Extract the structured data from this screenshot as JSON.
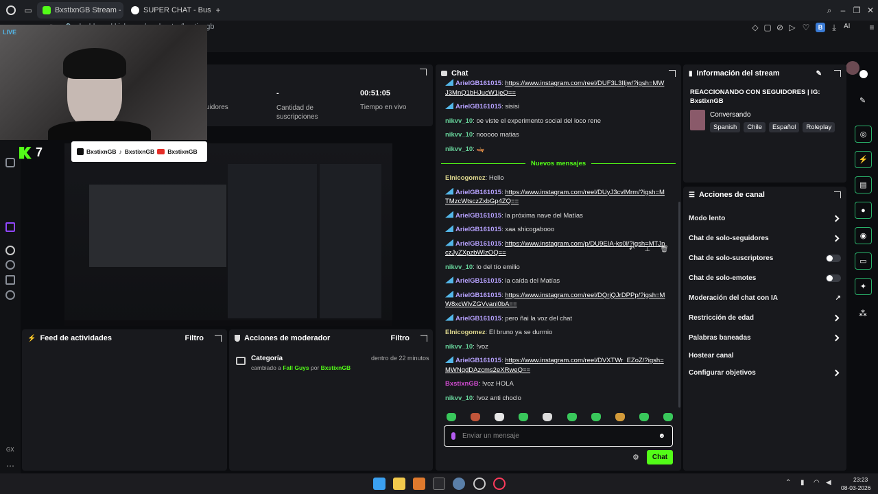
{
  "browser": {
    "tabs": [
      {
        "label": "BxstixnGB Stream - Kick D",
        "active": true
      },
      {
        "label": "SUPER CHAT - Buscar con",
        "active": false
      }
    ],
    "url": "dashboard.kick.com/moderator/bxstixngb",
    "ai_label": "AI",
    "profile_letter": "B"
  },
  "webcam": {
    "live_label": "LIVE",
    "kick_count": "7",
    "socials_handle_1": "BxstixnGB",
    "socials_handle_2": "BxstixnGB",
    "socials_handle_3": "BxstixnGB"
  },
  "stats": {
    "followers_label": "uidores",
    "subs_value": "-",
    "subs_label": "Cantidad de suscripciones",
    "uptime_value": "00:51:05",
    "uptime_label": "Tiempo en vivo"
  },
  "activity_feed": {
    "title": "Feed de actividades",
    "filter": "Filtro"
  },
  "mod_actions": {
    "title": "Acciones de moderador",
    "filter": "Filtro",
    "entry": {
      "title": "Categoría",
      "time": "dentro de 22 minutos",
      "prefix": "cambiado a",
      "game": "Fall Guys",
      "by": "por",
      "user": "BxstixnGB"
    }
  },
  "chat": {
    "title": "Chat",
    "new_messages": "Nuevos mensajes",
    "placeholder": "Enviar un mensaje",
    "send_label": "Chat",
    "messages_before": [
      {
        "user": "ArielGB161015",
        "color": "purple",
        "badge": true,
        "link": "https://www.instagram.com/reel/DUF3L3IIjw/?igsh=MWJ3MnQ1bHJucW1jeQ==",
        "text": ""
      },
      {
        "user": "ArielGB161015",
        "color": "purple",
        "badge": true,
        "link": "",
        "text": "sisisi"
      },
      {
        "user": "nikvv_10",
        "color": "green",
        "badge": false,
        "link": "",
        "text": "oe viste el experimento social del loco rene"
      },
      {
        "user": "nikvv_10",
        "color": "green",
        "badge": false,
        "link": "",
        "text": "nooooo matias"
      },
      {
        "user": "nikvv_10",
        "color": "green",
        "badge": false,
        "link": "",
        "text": "🛶"
      }
    ],
    "messages_after": [
      {
        "user": "Elnicogomez",
        "color": "yellow",
        "badge": false,
        "link": "",
        "text": "Hello"
      },
      {
        "user": "ArielGB161015",
        "color": "purple",
        "badge": true,
        "link": "https://www.instagram.com/reel/DUyJ3cvlMrm/?igsh=MTMzcWtsczZxbGp4ZQ==",
        "text": ""
      },
      {
        "user": "ArielGB161015",
        "color": "purple",
        "badge": true,
        "link": "",
        "text": "la próxima nave del Matías"
      },
      {
        "user": "ArielGB161015",
        "color": "purple",
        "badge": true,
        "link": "",
        "text": "xaa shicogabooo"
      },
      {
        "user": "ArielGB161015",
        "color": "purple",
        "badge": true,
        "link": "https://www.instagram.com/p/DU9EIA-ks0l/?igsh=MTJnczJyZXpzbWIzOQ==",
        "text": ""
      },
      {
        "user": "nikvv_10",
        "color": "green",
        "badge": false,
        "link": "",
        "text": "lo del tío emilio"
      },
      {
        "user": "ArielGB161015",
        "color": "purple",
        "badge": true,
        "link": "",
        "text": "la caída del Matías"
      },
      {
        "user": "ArielGB161015",
        "color": "purple",
        "badge": true,
        "link": "https://www.instagram.com/reel/DQrjQJrDPPp/?igsh=MW8xcWlvZGVvanl0bA==",
        "text": ""
      },
      {
        "user": "ArielGB161015",
        "color": "purple",
        "badge": true,
        "link": "",
        "text": "pero ñai la voz del chat"
      },
      {
        "user": "Elnicogomez",
        "color": "yellow",
        "badge": false,
        "link": "",
        "text": "El bruno ya se durmio"
      },
      {
        "user": "nikvv_10",
        "color": "green",
        "badge": false,
        "link": "",
        "text": "!voz"
      },
      {
        "user": "ArielGB161015",
        "color": "purple",
        "badge": true,
        "link": "https://www.instagram.com/reel/DVXTWr_EZoZ/?igsh=MWNqdDAzcms2eXRweQ==",
        "text": ""
      },
      {
        "user": "BxstixnGB",
        "color": "pink",
        "badge": false,
        "link": "",
        "text": "!voz HOLA"
      },
      {
        "user": "nikvv_10",
        "color": "green",
        "badge": false,
        "link": "",
        "text": "!voz anti choclo"
      }
    ]
  },
  "stream_info": {
    "title": "Información del stream",
    "stream_title": "REACCIONANDO CON SEGUIDORES | IG: BxstixnGB",
    "category": "Conversando",
    "tags": [
      "Spanish",
      "Chile",
      "Español",
      "Roleplay"
    ]
  },
  "channel_actions": {
    "title": "Acciones de canal",
    "items": [
      {
        "label": "Modo lento",
        "control": "chevron"
      },
      {
        "label": "Chat de solo-seguidores",
        "control": "chevron"
      },
      {
        "label": "Chat de solo-suscriptores",
        "control": "toggle"
      },
      {
        "label": "Chat de solo-emotes",
        "control": "toggle"
      },
      {
        "label": "Moderación del chat con IA",
        "control": "external"
      },
      {
        "label": "Restricción de edad",
        "control": "chevron"
      },
      {
        "label": "Palabras baneadas",
        "control": "chevron"
      },
      {
        "label": "Hostear canal",
        "control": "none"
      },
      {
        "label": "Configurar objetivos",
        "control": "chevron"
      }
    ]
  },
  "taskbar": {
    "time": "23:23",
    "date": "08-03-2026"
  },
  "rail": {
    "gx_label": "GX"
  },
  "colors": {
    "accent": "#53fc18",
    "badge": "#53b6e8"
  }
}
